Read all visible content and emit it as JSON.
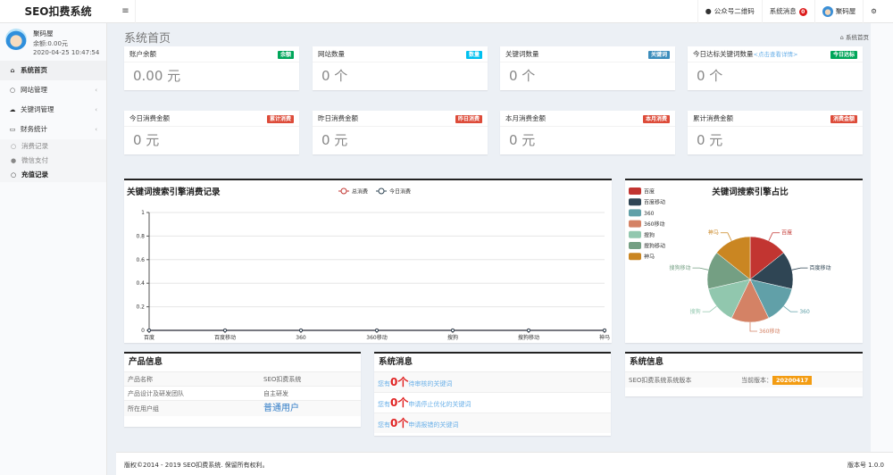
{
  "app": {
    "title": "SEO扣费系统",
    "menu_toggle": "≡"
  },
  "topnav": {
    "wechat_qr": "公众号二维码",
    "messages": "系统消息",
    "messages_count": "0",
    "username": "聚码屋",
    "settings_icon": "gears"
  },
  "sidebar": {
    "user": {
      "name": "聚码屋",
      "balance": "余额:0.00元",
      "datetime": "2020-04-25 10:47:54"
    },
    "items": [
      {
        "label": "系统首页",
        "icon": "home",
        "active": true
      },
      {
        "label": "网站管理",
        "icon": "circle",
        "expandable": true
      },
      {
        "label": "关键词管理",
        "icon": "cloud",
        "expandable": true
      },
      {
        "label": "财务统计",
        "icon": "credit-card",
        "expandable": true
      }
    ],
    "subitems": [
      {
        "label": "消费记录",
        "icon": "circle-o"
      },
      {
        "label": "微信支付",
        "icon": "wechat"
      },
      {
        "label": "充值记录",
        "icon": "circle-o",
        "bold": true
      }
    ]
  },
  "page": {
    "title": "系统首页",
    "breadcrumb": "系统首页"
  },
  "stats": [
    {
      "title": "账户余额",
      "label": "余额",
      "label_color": "#00a65a",
      "value": "0.00 元"
    },
    {
      "title": "网站数量",
      "label": "数量",
      "label_color": "#00c0ef",
      "value": "0 个"
    },
    {
      "title": "关键词数量",
      "label": "关键词",
      "label_color": "#3c8dbc",
      "value": "0 个"
    },
    {
      "title": "今日达标关键词数量",
      "hint": "<点击查看详情>",
      "label": "今日达标",
      "label_color": "#00a65a",
      "value": "0 个"
    },
    {
      "title": "今日消费金额",
      "label": "累计消费",
      "label_color": "#dd4b39",
      "value": "0 元"
    },
    {
      "title": "昨日消费金额",
      "label": "昨日消费",
      "label_color": "#dd4b39",
      "value": "0 元"
    },
    {
      "title": "本月消费金额",
      "label": "本月消费",
      "label_color": "#dd4b39",
      "value": "0 元"
    },
    {
      "title": "累计消费金额",
      "label": "消费金额",
      "label_color": "#dd4b39",
      "value": "0 元"
    }
  ],
  "chart_data": [
    {
      "type": "line",
      "title": "关键词搜索引擎消费记录",
      "categories": [
        "百度",
        "百度移动",
        "360",
        "360移动",
        "搜狗",
        "搜狗移动",
        "神马"
      ],
      "series": [
        {
          "name": "总消费",
          "color": "#c23531",
          "values": [
            0,
            0,
            0,
            0,
            0,
            0,
            0
          ]
        },
        {
          "name": "今日消费",
          "color": "#2f4554",
          "values": [
            0,
            0,
            0,
            0,
            0,
            0,
            0
          ]
        }
      ],
      "yticks": [
        "0",
        "0.2",
        "0.4",
        "0.6",
        "0.8",
        "1"
      ],
      "ylim": [
        0,
        1
      ],
      "grid": true,
      "legend": "top-center"
    },
    {
      "type": "pie",
      "title": "关键词搜索引擎占比",
      "slices": [
        {
          "name": "百度",
          "value": 1,
          "color": "#c23531"
        },
        {
          "name": "百度移动",
          "value": 1,
          "color": "#2f4554"
        },
        {
          "name": "360",
          "value": 1,
          "color": "#61a0a8"
        },
        {
          "name": "360移动",
          "value": 1,
          "color": "#d48265"
        },
        {
          "name": "搜狗",
          "value": 1,
          "color": "#91c7ae"
        },
        {
          "name": "搜狗移动",
          "value": 1,
          "color": "#749f83"
        },
        {
          "name": "神马",
          "value": 1,
          "color": "#ca8622"
        }
      ],
      "legend": "top-left"
    }
  ],
  "product": {
    "title": "产品信息",
    "rows": [
      {
        "k": "产品名称",
        "v": "SEO扣费系统"
      },
      {
        "k": "产品设计及研发团队",
        "v": "自主研发"
      },
      {
        "k": "所在用户组",
        "v": "普通用户"
      }
    ]
  },
  "messages": {
    "title": "系统消息",
    "rows": [
      {
        "pre": "您有",
        "num": "0个",
        "post": "待审核的关键词"
      },
      {
        "pre": "您有",
        "num": "0个",
        "post": "申请停止优化的关键词"
      },
      {
        "pre": "您有",
        "num": "0个",
        "post": "申请报错的关键词"
      }
    ]
  },
  "sysinfo": {
    "title": "系统信息",
    "label": "SEO扣费系统系统版本",
    "current_label": "当前版本：",
    "version": "20200417"
  },
  "footer": {
    "copyright": "版权©2014 - 2019 SEO扣费系统. 保留所有权利。",
    "version": "版本号 1.0.0"
  }
}
